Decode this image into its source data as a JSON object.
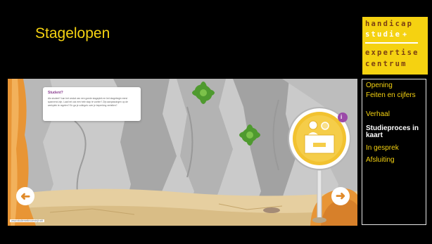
{
  "page": {
    "title": "Stagelopen"
  },
  "logo": {
    "line1": "handicap",
    "line2": "studie",
    "line2_plus": "+",
    "line3": "expertise",
    "line4": "centrum"
  },
  "scene": {
    "card": {
      "title": "Student?",
      "text": "Als student? kan het omdat van een goede stageplek en het stagebegin eerst spannend zijn. Laat het ook een hele stap te voelen? Zijn aanpassingen op de werkplek te regelen? En ga je collega's over je beperking vertellen?"
    },
    "footer_url": "www.studiemetinvoerdrijf.nl/tl",
    "prev_icon": "arrow-left-icon",
    "next_icon": "arrow-right-icon",
    "info_badge": "i"
  },
  "menu": {
    "items": [
      {
        "label": "Opening",
        "active": false
      },
      {
        "label": "Feiten en cijfers",
        "active": false
      },
      {
        "label": "Verhaal",
        "active": false
      },
      {
        "label": "Studieproces in kaart",
        "active": true
      },
      {
        "label": "In gesprek",
        "active": false
      },
      {
        "label": "Afsluiting",
        "active": false
      }
    ]
  },
  "colors": {
    "accent_yellow": "#f5d211",
    "background": "#000000",
    "arrow_orange": "#e08a2a",
    "info_purple": "#9b4aa8"
  }
}
